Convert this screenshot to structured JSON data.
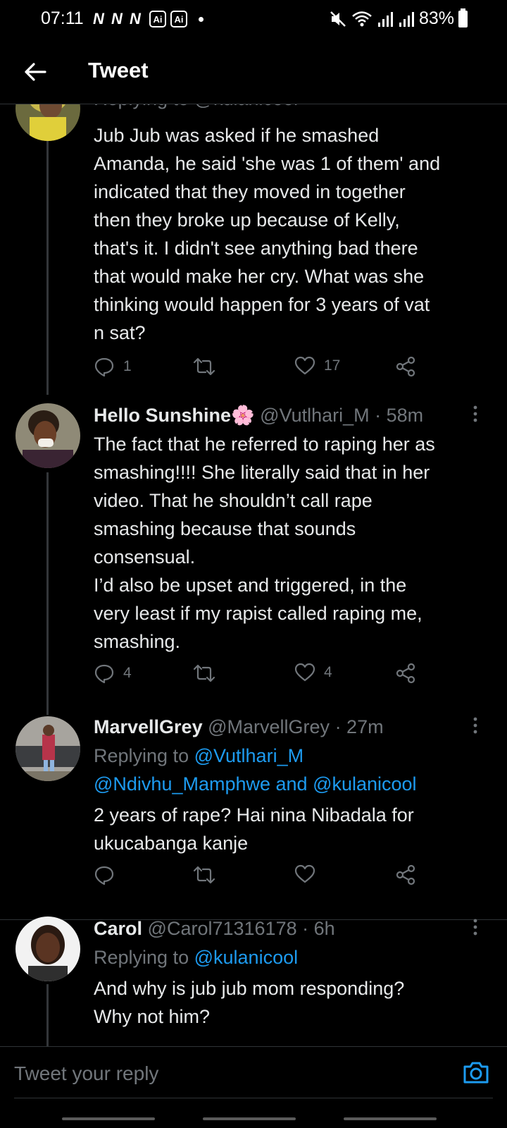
{
  "status_bar": {
    "time": "07:11",
    "left_icons": [
      "N",
      "N",
      "N"
    ],
    "ai_badges": [
      "Ai",
      "Ai"
    ],
    "battery": "83%"
  },
  "header": {
    "title": "Tweet"
  },
  "tweets": [
    {
      "reply_to_partial": "Replying to @kulanicool",
      "text": "Jub Jub was asked if he smashed\nAmanda, he said 'she was 1 of them' and\nindicated that they moved in together\nthen they broke up because of Kelly,\nthat's it. I didn't see anything bad there\nthat would make her cry. What was she\nthinking would happen for 3 years of vat\nn sat?",
      "replies": "1",
      "retweets": "",
      "likes": "17"
    },
    {
      "name": "Hello Sunshine🌸",
      "handle": "@Vutlhari_M",
      "time": "· 58m",
      "text": "The fact that he referred to raping her as\nsmashing!!!! She literally said that in her\nvideo. That he shouldn’t call rape\nsmashing because that sounds\nconsensual.\nI’d also be upset and triggered, in the\nvery least if my rapist called raping me,\nsmashing.",
      "replies": "4",
      "retweets": "",
      "likes": "4"
    },
    {
      "name": "MarvellGrey",
      "handle": "@MarvellGrey",
      "time": "· 27m",
      "replying_prefix": "Replying to",
      "replying_line1": "@Vutlhari_M",
      "replying_line2": "@Ndivhu_Mamphwe and @kulanicool",
      "text": "2 years of rape? Hai nina Nibadala for\nukucabanga kanje",
      "replies": "",
      "retweets": "",
      "likes": ""
    },
    {
      "name": "Carol",
      "handle": "@Carol71316178",
      "time": "· 6h",
      "replying_prefix": "Replying to",
      "replying_line1": "@kulanicool",
      "text": "And why is jub jub mom responding?\nWhy not him?"
    }
  ],
  "composer": {
    "placeholder": "Tweet your reply"
  },
  "colors": {
    "background": "#000000",
    "text": "#e7e9ea",
    "secondary": "#71767b",
    "link": "#1d9bf0",
    "divider": "#2f3336"
  },
  "icons": [
    "back-arrow-icon",
    "reply-icon",
    "retweet-icon",
    "like-icon",
    "share-icon",
    "more-icon",
    "camera-icon"
  ]
}
